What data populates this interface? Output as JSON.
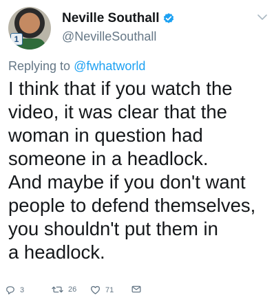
{
  "user": {
    "display_name": "Neville Southall",
    "handle": "@NevilleSouthall",
    "verified": true,
    "avatar_badge": "1"
  },
  "reply": {
    "prefix": "Replying to",
    "mention": "@fwhatworld"
  },
  "tweet_lines": [
    "I think that if you watch the",
    "video, it was clear that the",
    "woman in question had",
    "someone in a headlock.",
    "And maybe if you don't want",
    "people to defend themselves,",
    "you shouldn't put them in",
    "a headlock."
  ],
  "actions": {
    "replies": "3",
    "retweets": "26",
    "likes": "71"
  },
  "colors": {
    "accent": "#1da1f2",
    "secondary_text": "#657786",
    "primary_text": "#14171a"
  },
  "icons": [
    "verified-badge-icon",
    "chevron-down-icon",
    "reply-icon",
    "retweet-icon",
    "like-icon",
    "direct-message-icon"
  ]
}
